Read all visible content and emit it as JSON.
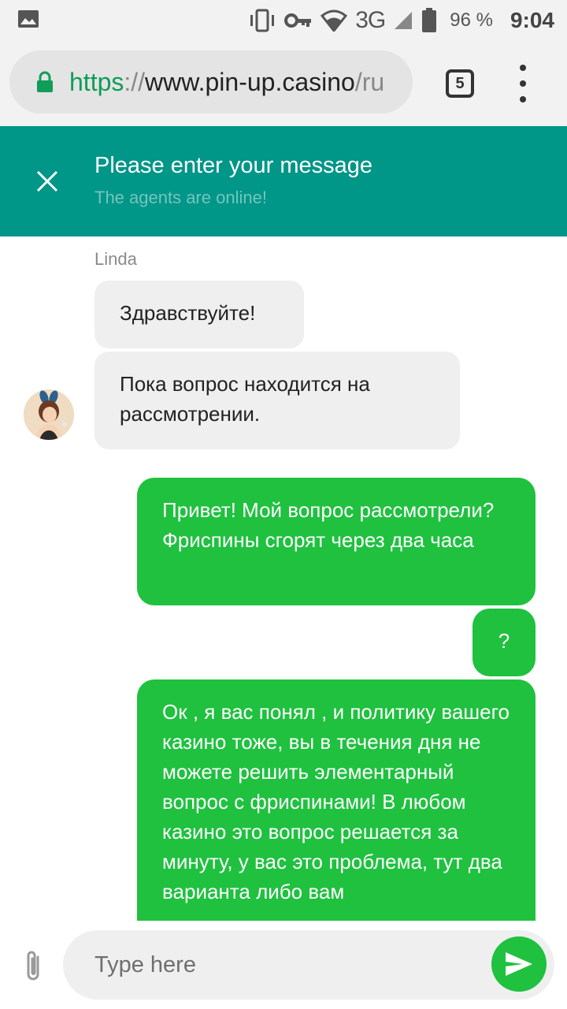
{
  "status_bar": {
    "network": "3G",
    "battery": "96 %",
    "time": "9:04",
    "icons": [
      "image-icon",
      "vibrate-icon",
      "vpn-key-icon",
      "wifi-icon",
      "signal-icon",
      "battery-icon"
    ]
  },
  "browser": {
    "url_scheme": "https",
    "url_sep": "://",
    "url_host": "www.pin-up.casino",
    "url_tail": "/ru",
    "tab_count": "5"
  },
  "chat_header": {
    "title": "Please enter your message",
    "subtitle": "The agents are online!"
  },
  "messages": {
    "agent_name": "Linda",
    "incoming": [
      "Здравствуйте!",
      "Пока вопрос находится на рассмотрении."
    ],
    "outgoing": [
      "Привет! Мой вопрос рассмотрели? Фриспины сгорят через два часа",
      "?",
      "Ок , я вас понял , и политику вашего казино тоже, вы в течения дня не можете решить элементарный вопрос с фриспинами! В любом казино это вопрос решается за минуту, у вас это проблема, тут два варианта либо вам"
    ]
  },
  "input": {
    "placeholder": "Type here"
  },
  "colors": {
    "header": "#009688",
    "outgoing_bubble": "#1fc13f",
    "incoming_bubble": "#efefef",
    "lock": "#0f9d58"
  }
}
